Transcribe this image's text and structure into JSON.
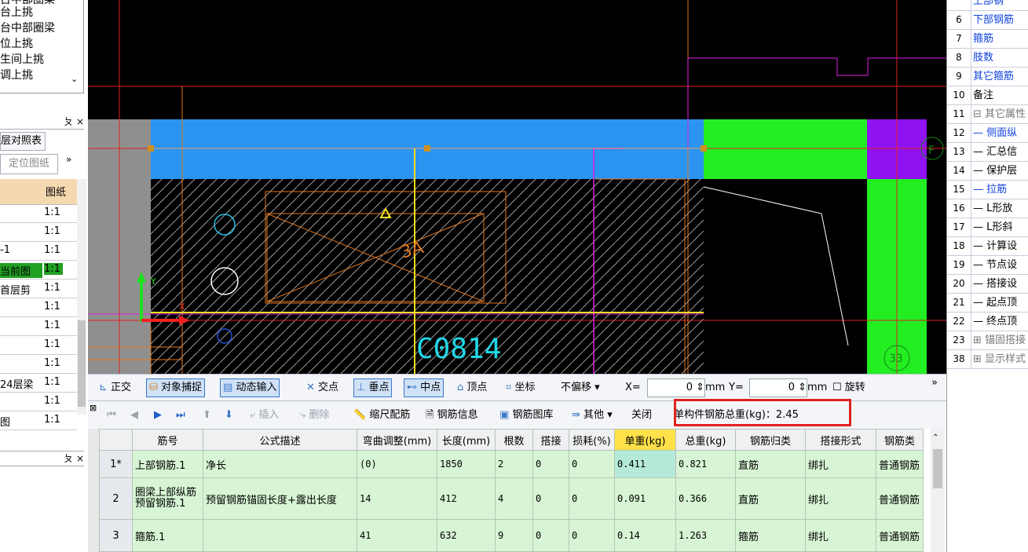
{
  "left_panel": {
    "tree_items": [
      "台中部圈梁",
      "台上挑",
      "台中部圈梁",
      "位上挑",
      "生间上挑",
      "调上挑"
    ],
    "pane_close": "ㄆ ×",
    "tab_label": "层对照表",
    "locate_button": "定位图纸",
    "header_col": "图纸",
    "rows": [
      {
        "name": "",
        "scale": "1:1"
      },
      {
        "name": "",
        "scale": "1:1"
      },
      {
        "name": "-1",
        "scale": "1:1"
      },
      {
        "name": "当前图",
        "scale": "1:1"
      },
      {
        "name": "首层剪",
        "scale": "1:1"
      },
      {
        "name": "",
        "scale": "1:1"
      },
      {
        "name": "",
        "scale": "1:1"
      },
      {
        "name": "",
        "scale": "1:1"
      },
      {
        "name": "",
        "scale": "1:1"
      },
      {
        "name": "24层梁",
        "scale": "1:1"
      },
      {
        "name": "",
        "scale": "1:1"
      },
      {
        "name": "图",
        "scale": "1:1"
      }
    ],
    "pane2_close": "ㄆ ×"
  },
  "canvas": {
    "label_window": "C0814",
    "label_axis_y": "Y",
    "label_axis_x": "X",
    "label_grid_f": "F",
    "label_grid_33": "33",
    "label_3a": "3A"
  },
  "snap_toolbar": {
    "ortho": "正交",
    "object_snap": "对象捕捉",
    "dynamic_input": "动态输入",
    "intersection": "交点",
    "perpendicular": "垂点",
    "midpoint": "中点",
    "vertex": "顶点",
    "coordinate": "坐标",
    "offset_select": "不偏移",
    "x_label": "X=",
    "x_value": "0",
    "unit1": "mm",
    "y_label": "Y=",
    "y_value": "0",
    "unit2": "mm",
    "rotate": "旋转"
  },
  "rebar_toolbar": {
    "insert": "插入",
    "delete": "删除",
    "scale_rebar": "缩尺配筋",
    "rebar_info": "钢筋信息",
    "rebar_library": "钢筋图库",
    "other": "其他",
    "close": "关闭",
    "total_weight_label": "单构件钢筋总重(kg)：2.45"
  },
  "table": {
    "headers": [
      "筋号",
      "公式描述",
      "弯曲调整(mm)",
      "长度(mm)",
      "根数",
      "搭接",
      "损耗(%)",
      "单重(kg)",
      "总重(kg)",
      "钢筋归类",
      "搭接形式",
      "钢筋类"
    ],
    "rows": [
      {
        "no": "1*",
        "name": "上部钢筋.1",
        "formula": "净长",
        "bend": "(0)",
        "length": "1850",
        "count": "2",
        "lap": "0",
        "loss": "0",
        "unit_w": "0.411",
        "total_w": "0.821",
        "category": "直筋",
        "lap_form": "绑扎",
        "type": "普通钢筋"
      },
      {
        "no": "2",
        "name": "圈梁上部纵筋预留钢筋.1",
        "formula": "预留钢筋锚固长度+露出长度",
        "bend": "14",
        "length": "412",
        "count": "4",
        "lap": "0",
        "loss": "0",
        "unit_w": "0.091",
        "total_w": "0.366",
        "category": "直筋",
        "lap_form": "绑扎",
        "type": "普通钢筋"
      },
      {
        "no": "3",
        "name": "箍筋.1",
        "formula": "",
        "bend": "41",
        "length": "632",
        "count": "9",
        "lap": "0",
        "loss": "0",
        "unit_w": "0.14",
        "total_w": "1.263",
        "category": "箍筋",
        "lap_form": "绑扎",
        "type": "普通钢筋"
      }
    ]
  },
  "right_panel": {
    "rows": [
      {
        "num": "",
        "name": "上部钢",
        "style": "blue"
      },
      {
        "num": "6",
        "name": "下部钢筋",
        "style": "blue"
      },
      {
        "num": "7",
        "name": "箍筋",
        "style": "blue"
      },
      {
        "num": "8",
        "name": "肢数",
        "style": "blue"
      },
      {
        "num": "9",
        "name": "其它箍筋",
        "style": "blue"
      },
      {
        "num": "10",
        "name": "备注",
        "style": "black"
      },
      {
        "num": "11",
        "name": "⊟ 其它属性",
        "style": "gray"
      },
      {
        "num": "12",
        "name": "— 侧面纵",
        "style": "blue"
      },
      {
        "num": "13",
        "name": "— 汇总信",
        "style": "black"
      },
      {
        "num": "14",
        "name": "— 保护层",
        "style": "black"
      },
      {
        "num": "15",
        "name": "— 拉筋",
        "style": "blue"
      },
      {
        "num": "16",
        "name": "— L形放",
        "style": "black"
      },
      {
        "num": "17",
        "name": "— L形斜",
        "style": "black"
      },
      {
        "num": "18",
        "name": "— 计算设",
        "style": "black"
      },
      {
        "num": "19",
        "name": "— 节点设",
        "style": "black"
      },
      {
        "num": "20",
        "name": "— 搭接设",
        "style": "black"
      },
      {
        "num": "21",
        "name": "— 起点顶",
        "style": "black"
      },
      {
        "num": "22",
        "name": "— 终点顶",
        "style": "black"
      },
      {
        "num": "23",
        "name": "⊞ 锚固搭接",
        "style": "gray"
      },
      {
        "num": "38",
        "name": "⊞ 显示样式",
        "style": "gray"
      }
    ]
  }
}
